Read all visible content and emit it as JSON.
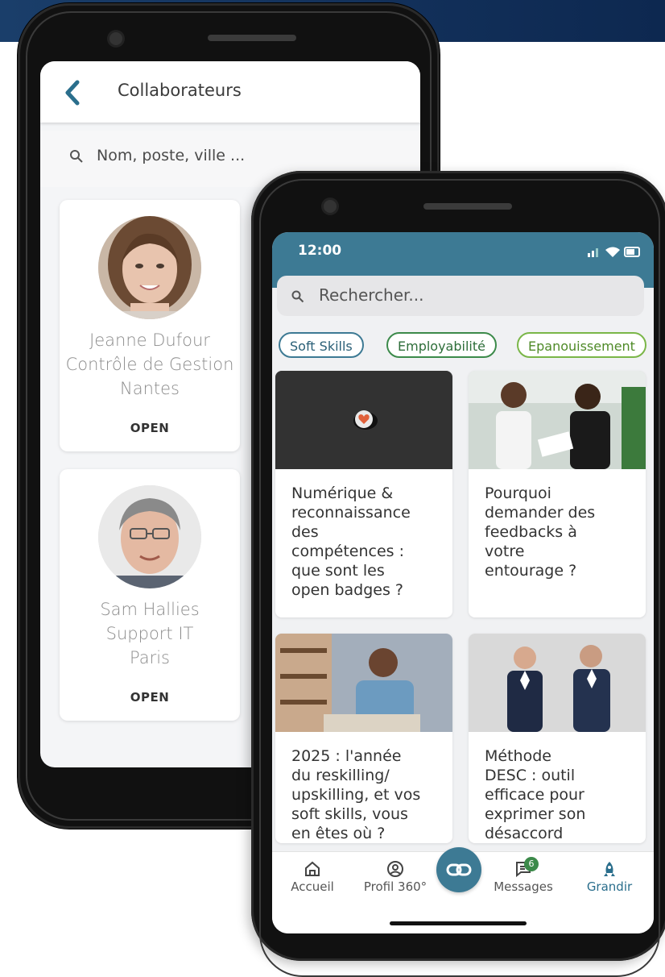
{
  "back_screen": {
    "title": "Collaborateurs",
    "search_placeholder": "Nom, poste, ville ...",
    "people": [
      {
        "name": "Jeanne Dufour",
        "role": "Contrôle de Gestion",
        "city": "Nantes",
        "status": "OPEN"
      },
      {
        "name": "Sam Hallies",
        "role": "Support IT",
        "city": "Paris",
        "status": "OPEN"
      }
    ]
  },
  "front_screen": {
    "status_time": "12:00",
    "search_placeholder": "Rechercher...",
    "chips": [
      "Soft Skills",
      "Employabilité",
      "Epanouissement"
    ],
    "articles": [
      {
        "title": "Numérique &\nreconnaissance\ndes\ncompétences :\nque sont les\nopen badges ?"
      },
      {
        "title": "Pourquoi\ndemander des\nfeedbacks à\nvotre\nentourage ?"
      },
      {
        "title": "2025 : l'année\ndu reskilling/\nupskilling, et vos\nsoft skills, vous\nen êtes où ?"
      },
      {
        "title": "Méthode\nDESC : outil\nefficace pour\nexprimer son\ndésaccord"
      }
    ],
    "nav": {
      "home": "Accueil",
      "profile": "Profil 360°",
      "messages": "Messages",
      "messages_badge": "6",
      "grow": "Grandir"
    }
  },
  "colors": {
    "primary": "#3d7a94",
    "green": "#3c8a4a",
    "light_green": "#7ab648",
    "banner": "#12305a"
  }
}
